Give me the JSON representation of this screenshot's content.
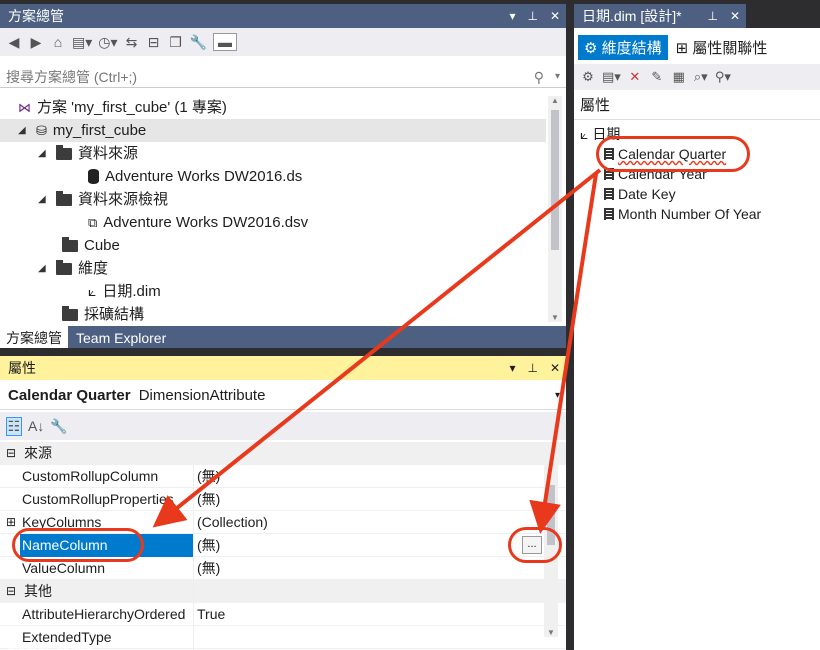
{
  "solution_explorer": {
    "title": "方案總管",
    "title_buttons": [
      "▾",
      "⊥",
      "✕"
    ],
    "search_placeholder": "搜尋方案總管 (Ctrl+;)",
    "tree": [
      {
        "label": "方案 'my_first_cube' (1 專案)",
        "icon": "solution-icon"
      },
      {
        "label": "my_first_cube",
        "icon": "project-icon",
        "bold": true
      },
      {
        "label": "資料來源",
        "icon": "folder-icon"
      },
      {
        "label": "Adventure Works DW2016.ds",
        "icon": "datasource-icon"
      },
      {
        "label": "資料來源檢視",
        "icon": "folder-icon"
      },
      {
        "label": "Adventure Works DW2016.dsv",
        "icon": "dsv-icon"
      },
      {
        "label": "Cube",
        "icon": "folder-icon"
      },
      {
        "label": "維度",
        "icon": "folder-icon"
      },
      {
        "label": "日期.dim",
        "icon": "dimension-icon"
      },
      {
        "label": "採礦結構",
        "icon": "folder-icon"
      }
    ],
    "tabs": [
      "方案總管",
      "Team Explorer"
    ]
  },
  "properties": {
    "title": "屬性",
    "object_name": "Calendar Quarter",
    "object_type": "DimensionAttribute",
    "categories": [
      {
        "name": "來源",
        "rows": [
          {
            "name": "CustomRollupColumn",
            "value": "(無)"
          },
          {
            "name": "CustomRollupProperties",
            "value": "(無)"
          },
          {
            "name": "KeyColumns",
            "value": "(Collection)"
          },
          {
            "name": "NameColumn",
            "value": "(無)"
          },
          {
            "name": "ValueColumn",
            "value": "(無)"
          }
        ]
      },
      {
        "name": "其他",
        "rows": [
          {
            "name": "AttributeHierarchyOrdered",
            "value": "True"
          },
          {
            "name": "ExtendedType",
            "value": ""
          }
        ]
      }
    ],
    "ellipsis_label": "...",
    "bottom_cut_label": "NameColumn"
  },
  "designer": {
    "title": "日期.dim [設計]*",
    "tabs": [
      "維度結構",
      "屬性關聯性"
    ],
    "attributes_header": "屬性",
    "dimension_name": "日期",
    "attributes": [
      "Calendar Quarter",
      "Calendar Year",
      "Date Key",
      "Month Number Of Year"
    ]
  },
  "colors": {
    "accent_dark": "#4d6082",
    "selected_row": "#007acc",
    "callout": "#e8391c",
    "properties_title": "#fff29d"
  }
}
